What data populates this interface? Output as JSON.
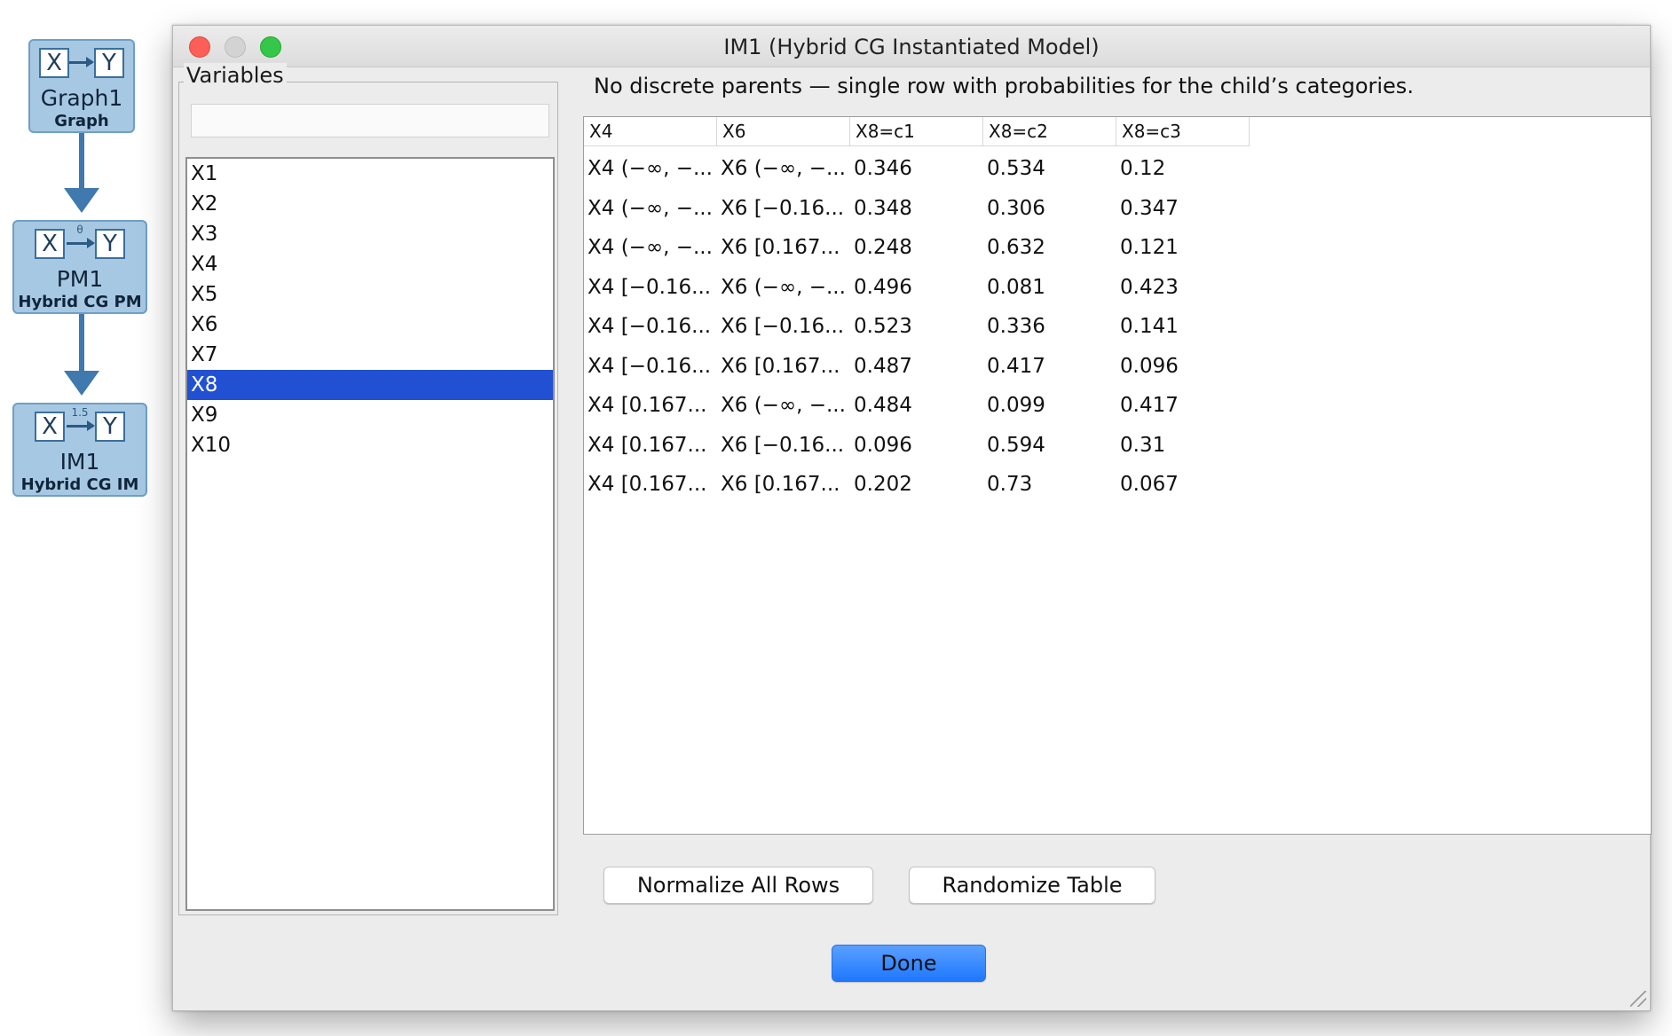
{
  "workbench": {
    "nodes": [
      {
        "title": "Graph1",
        "subtitle": "Graph",
        "icon_x": "X",
        "icon_y": "Y",
        "icon_label": ""
      },
      {
        "title": "PM1",
        "subtitle": "Hybrid CG PM",
        "icon_x": "X",
        "icon_y": "Y",
        "icon_label": "θ"
      },
      {
        "title": "IM1",
        "subtitle": "Hybrid CG IM",
        "icon_x": "X",
        "icon_y": "Y",
        "icon_label": "1.5"
      }
    ]
  },
  "window": {
    "title": "IM1 (Hybrid CG Instantiated Model)",
    "controls": {
      "close": "close",
      "minimize": "minimize",
      "zoom": "zoom"
    }
  },
  "variables": {
    "legend": "Variables",
    "search_value": "",
    "items": [
      "X1",
      "X2",
      "X3",
      "X4",
      "X5",
      "X6",
      "X7",
      "X8",
      "X9",
      "X10"
    ],
    "selected": "X8"
  },
  "info_text": "No discrete parents — single row with probabilities for the child’s categories.",
  "table": {
    "headers": [
      "X4",
      "X6",
      "X8=c1",
      "X8=c2",
      "X8=c3"
    ],
    "rows": [
      [
        "X4 (−∞, −...",
        "X6 (−∞, −...",
        "0.346",
        "0.534",
        "0.12"
      ],
      [
        "X4 (−∞, −...",
        "X6 [−0.16...",
        "0.348",
        "0.306",
        "0.347"
      ],
      [
        "X4 (−∞, −...",
        "X6 [0.167...",
        "0.248",
        "0.632",
        "0.121"
      ],
      [
        "X4 [−0.16...",
        "X6 (−∞, −...",
        "0.496",
        "0.081",
        "0.423"
      ],
      [
        "X4 [−0.16...",
        "X6 [−0.16...",
        "0.523",
        "0.336",
        "0.141"
      ],
      [
        "X4 [−0.16...",
        "X6 [0.167...",
        "0.487",
        "0.417",
        "0.096"
      ],
      [
        "X4 [0.167...",
        "X6 (−∞, −...",
        "0.484",
        "0.099",
        "0.417"
      ],
      [
        "X4 [0.167...",
        "X6 [−0.16...",
        "0.096",
        "0.594",
        "0.31"
      ],
      [
        "X4 [0.167...",
        "X6 [0.167...",
        "0.202",
        "0.73",
        "0.067"
      ]
    ]
  },
  "buttons": {
    "normalize": "Normalize All Rows",
    "randomize": "Randomize Table",
    "done": "Done"
  },
  "colors": {
    "node_fill": "#a7c8e3",
    "edge": "#3f79ad",
    "selection": "#2150d3",
    "done_button": "#1f78ff"
  }
}
